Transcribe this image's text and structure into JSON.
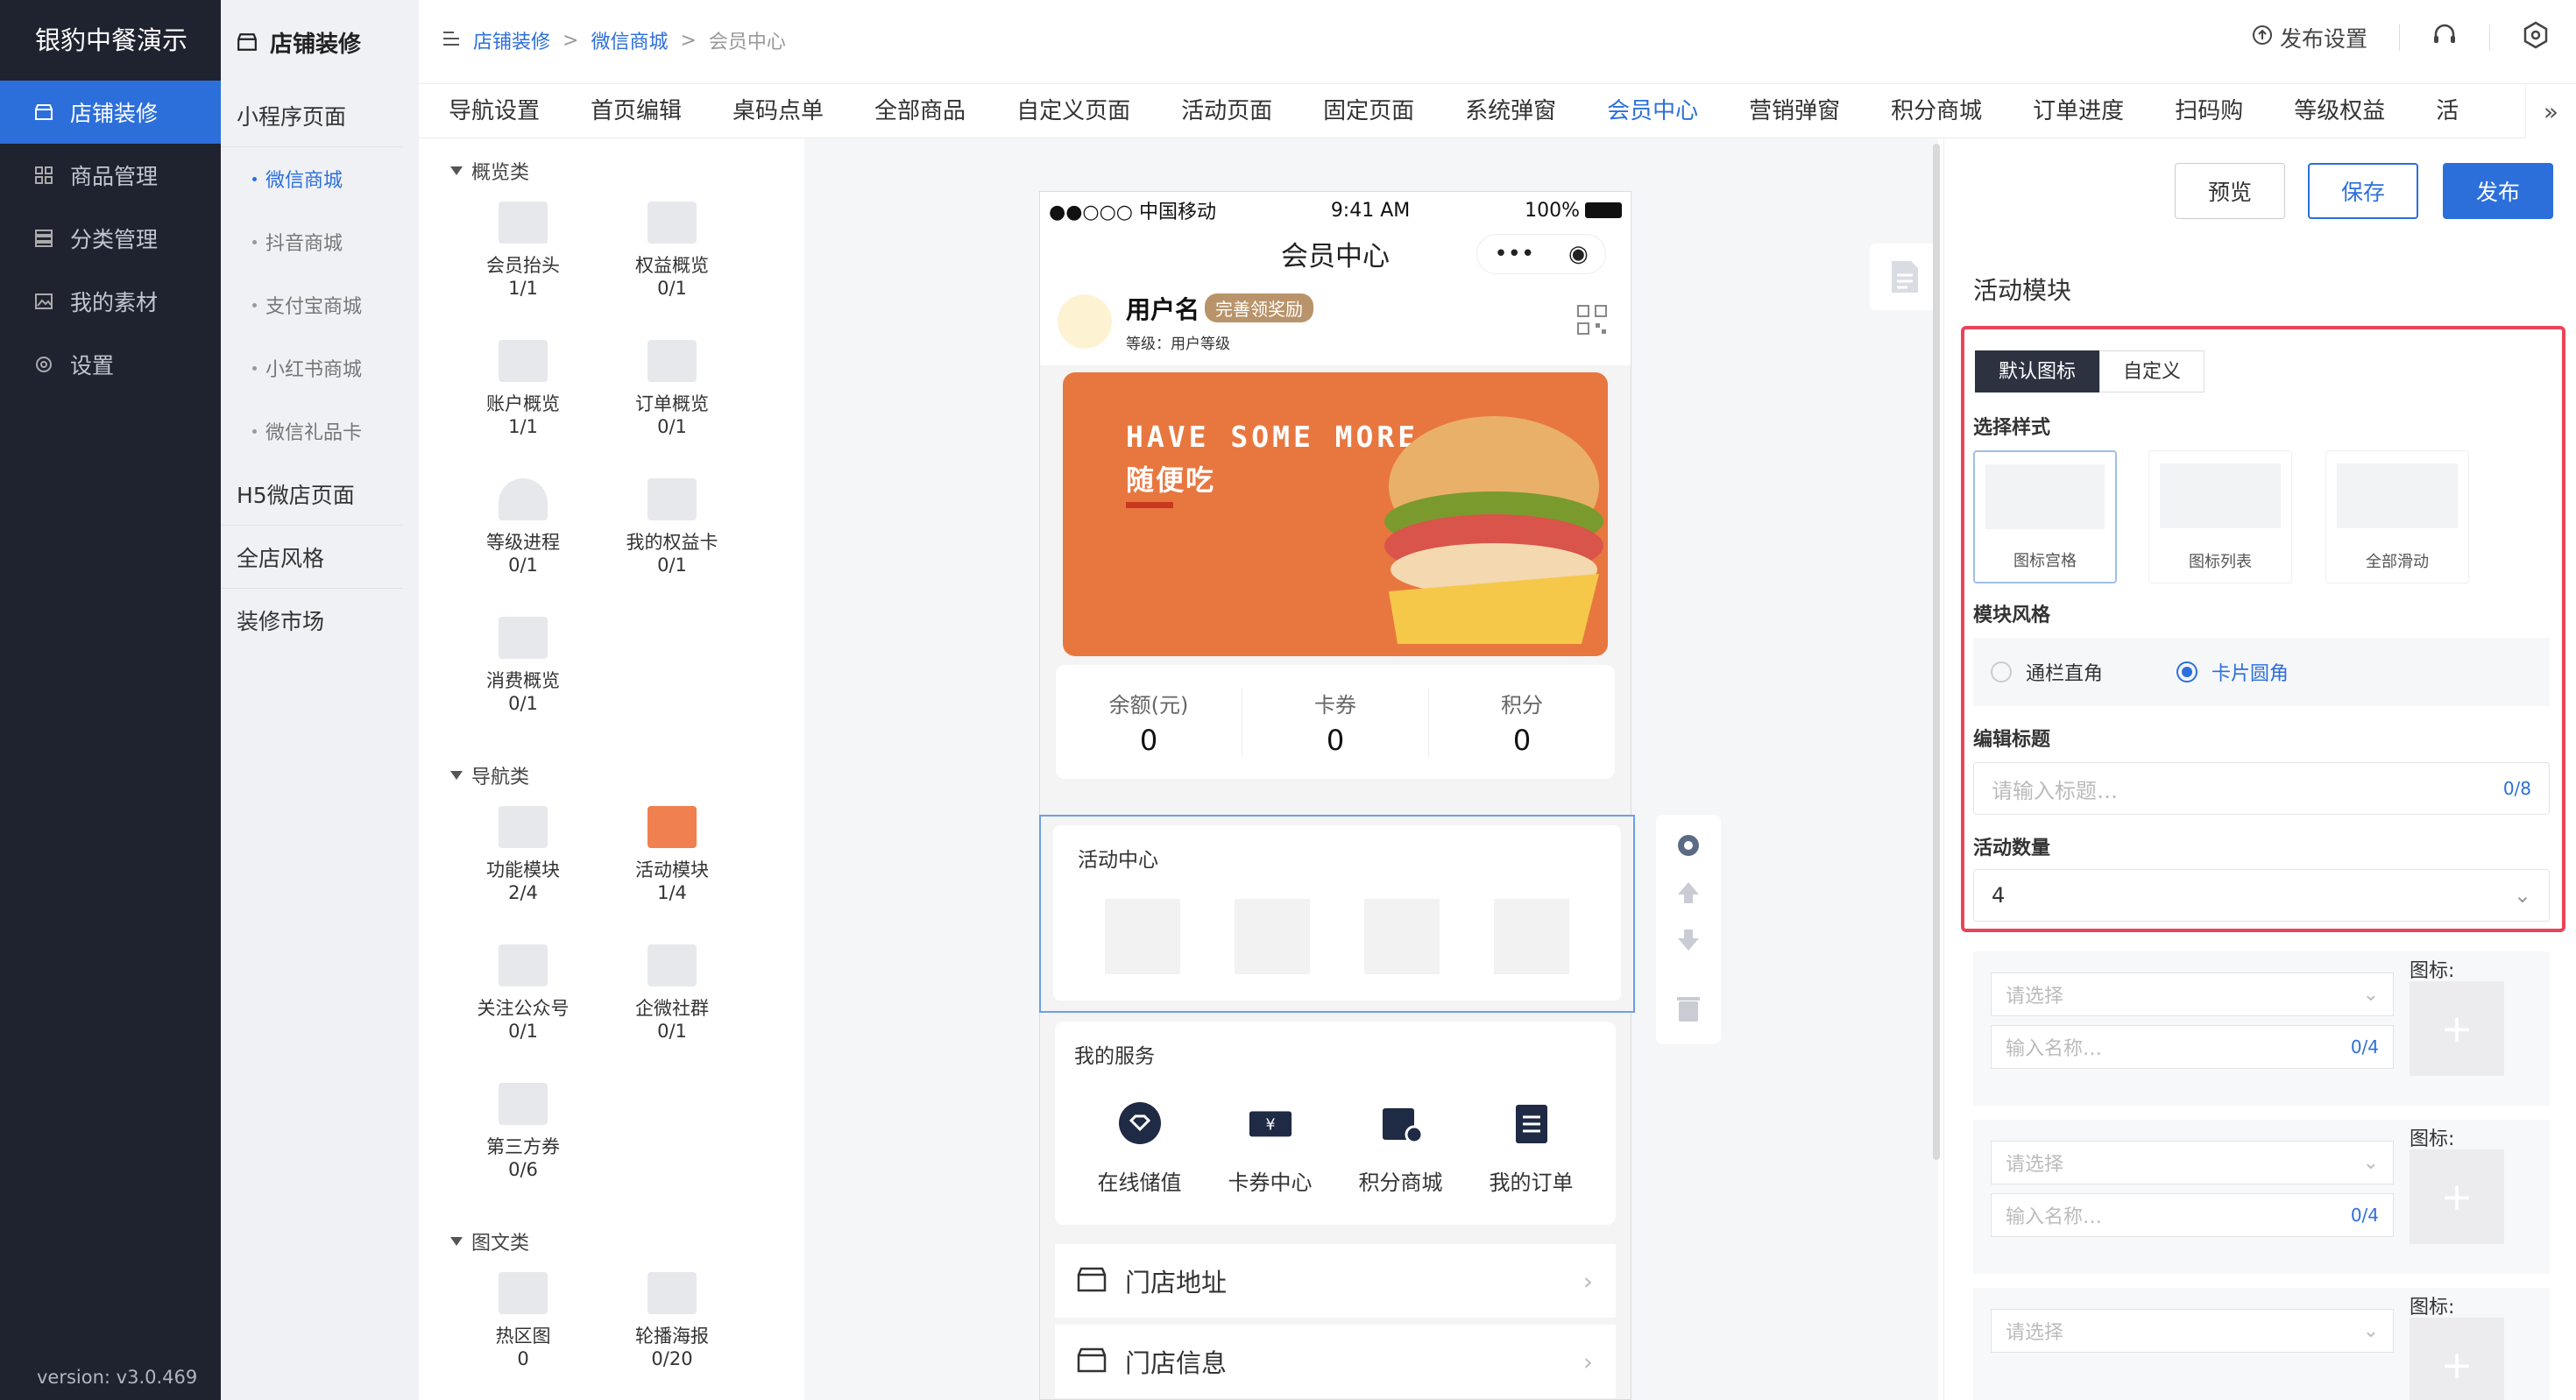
{
  "app": {
    "brand": "银豹中餐演示",
    "version": "version: v3.0.469"
  },
  "nav": [
    {
      "label": "店铺装修",
      "icon": "store-icon",
      "active": true
    },
    {
      "label": "商品管理",
      "icon": "grid-icon"
    },
    {
      "label": "分类管理",
      "icon": "list-icon"
    },
    {
      "label": "我的素材",
      "icon": "image-icon"
    },
    {
      "label": "设置",
      "icon": "gear-icon"
    }
  ],
  "subnav": {
    "title": "店铺装修",
    "items": [
      {
        "label": "小程序页面",
        "type": "group"
      },
      {
        "label": "微信商城",
        "type": "sub",
        "active": true
      },
      {
        "label": "抖音商城",
        "type": "sub"
      },
      {
        "label": "支付宝商城",
        "type": "sub"
      },
      {
        "label": "小红书商城",
        "type": "sub"
      },
      {
        "label": "微信礼品卡",
        "type": "sub"
      },
      {
        "label": "H5微店页面",
        "type": "group"
      },
      {
        "label": "全店风格",
        "type": "group"
      },
      {
        "label": "装修市场",
        "type": "group"
      }
    ]
  },
  "breadcrumb": {
    "items": [
      "店铺装修",
      "微信商城",
      "会员中心"
    ],
    "sep": ">"
  },
  "topright": {
    "publish_settings": "发布设置"
  },
  "tabs": [
    "导航设置",
    "首页编辑",
    "桌码点单",
    "全部商品",
    "自定义页面",
    "活动页面",
    "固定页面",
    "系统弹窗",
    "会员中心",
    "营销弹窗",
    "积分商城",
    "订单进度",
    "扫码购",
    "等级权益",
    "活"
  ],
  "active_tab": "会员中心",
  "components": {
    "cat1": "概览类",
    "overview": [
      {
        "name": "会员抬头",
        "count": "1/1"
      },
      {
        "name": "权益概览",
        "count": "0/1"
      },
      {
        "name": "账户概览",
        "count": "1/1"
      },
      {
        "name": "订单概览",
        "count": "0/1"
      },
      {
        "name": "等级进程",
        "count": "0/1"
      },
      {
        "name": "我的权益卡",
        "count": "0/1"
      },
      {
        "name": "消费概览",
        "count": "0/1"
      }
    ],
    "cat2": "导航类",
    "navs": [
      {
        "name": "功能模块",
        "count": "2/4"
      },
      {
        "name": "活动模块",
        "count": "1/4"
      },
      {
        "name": "关注公众号",
        "count": "0/1"
      },
      {
        "name": "企微社群",
        "count": "0/1"
      },
      {
        "name": "第三方券",
        "count": "0/6"
      }
    ],
    "cat3": "图文类",
    "media": [
      {
        "name": "热区图",
        "count": "0"
      },
      {
        "name": "轮播海报",
        "count": "0/20"
      }
    ]
  },
  "phone": {
    "carrier": "●●○○○ 中国移动",
    "time": "9:41 AM",
    "battery": "100%",
    "title": "会员中心",
    "user": {
      "name": "用户名",
      "badge": "完善领奖励",
      "level": "等级：用户等级"
    },
    "banner": {
      "line1": "HAVE SOME MORE",
      "line2": "随便吃"
    },
    "stats": [
      {
        "label": "余额(元)",
        "value": "0"
      },
      {
        "label": "卡券",
        "value": "0"
      },
      {
        "label": "积分",
        "value": "0"
      }
    ],
    "activity_title": "活动中心",
    "services_title": "我的服务",
    "services": [
      {
        "label": "在线储值",
        "icon": "wallet-icon"
      },
      {
        "label": "卡券中心",
        "icon": "coupon-icon"
      },
      {
        "label": "积分商城",
        "icon": "bag-icon"
      },
      {
        "label": "我的订单",
        "icon": "clipboard-icon"
      }
    ],
    "rows": [
      {
        "label": "门店地址"
      },
      {
        "label": "门店信息"
      }
    ]
  },
  "actions": {
    "preview": "预览",
    "save": "保存",
    "publish": "发布"
  },
  "panel": {
    "title": "活动模块",
    "seg": [
      "默认图标",
      "自定义"
    ],
    "style_label": "选择样式",
    "styles": [
      "图标宫格",
      "图标列表",
      "全部滑动"
    ],
    "module_style_label": "模块风格",
    "radios": [
      "通栏直角",
      "卡片圆角"
    ],
    "title_label": "编辑标题",
    "title_placeholder": "请输入标题…",
    "title_count": "0/8",
    "qty_label": "活动数量",
    "qty_value": "4",
    "rep": {
      "select": "请选择",
      "name": "输入名称…",
      "count": "0/4",
      "icon_label": "图标:"
    }
  }
}
